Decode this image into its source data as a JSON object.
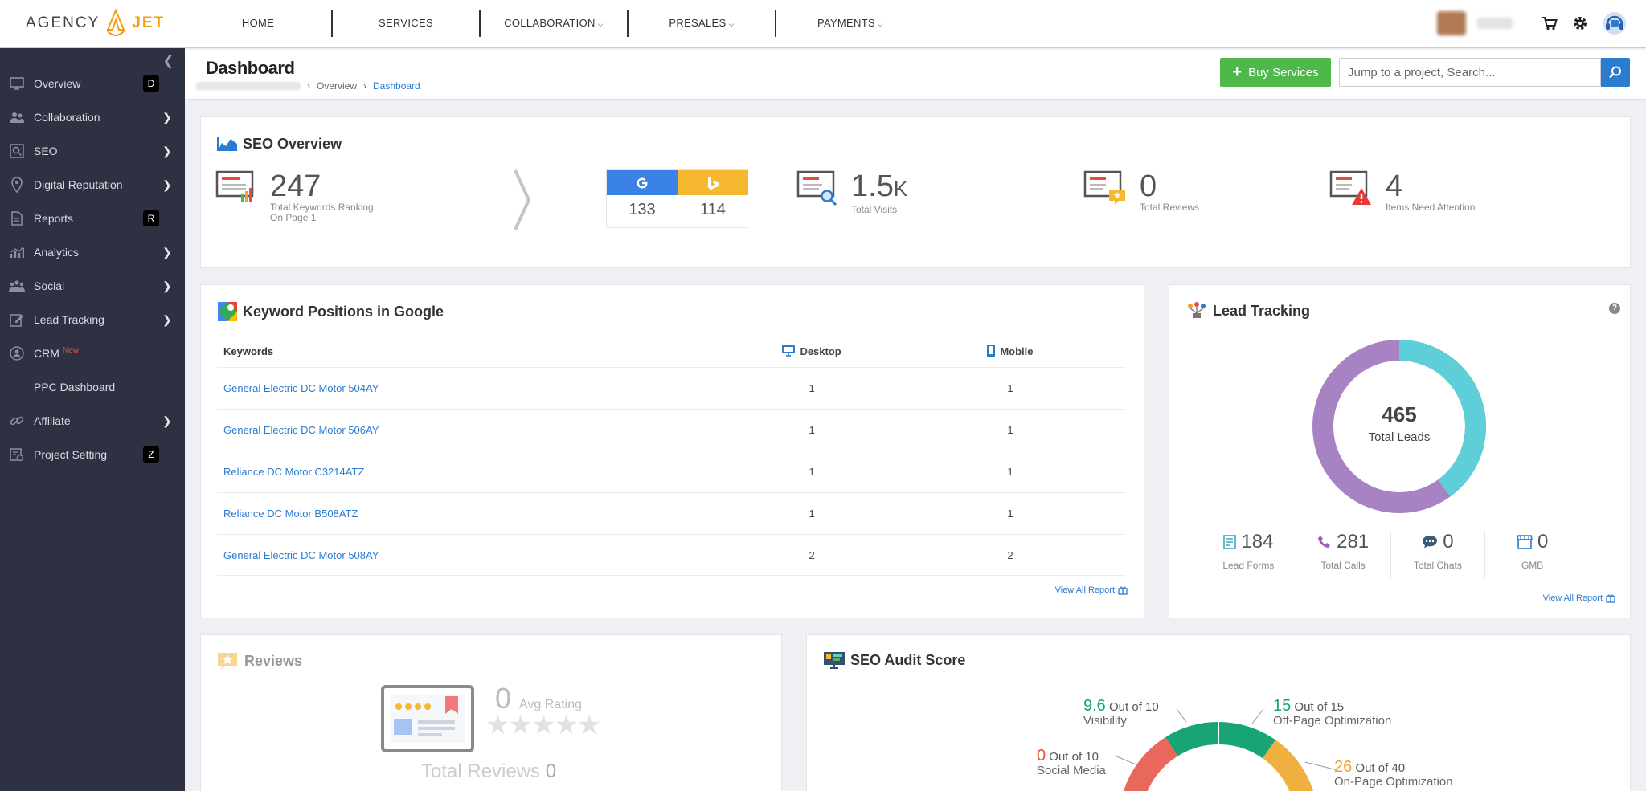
{
  "brand": {
    "name_left": "AGENCY",
    "name_right": "JET"
  },
  "nav": {
    "items": [
      "HOME",
      "SERVICES",
      "COLLABORATION",
      "PRESALES",
      "PAYMENTS"
    ]
  },
  "sidebar": {
    "items": [
      {
        "label": "Overview",
        "hotkey": "D"
      },
      {
        "label": "Collaboration"
      },
      {
        "label": "SEO"
      },
      {
        "label": "Digital Reputation"
      },
      {
        "label": "Reports",
        "hotkey": "R"
      },
      {
        "label": "Analytics"
      },
      {
        "label": "Social"
      },
      {
        "label": "Lead Tracking"
      },
      {
        "label": "CRM",
        "badge": "New"
      },
      {
        "label": "PPC Dashboard"
      },
      {
        "label": "Affiliate"
      },
      {
        "label": "Project Setting",
        "hotkey": "Z"
      }
    ]
  },
  "header": {
    "title": "Dashboard",
    "breadcrumb": [
      "Overview",
      "Dashboard"
    ],
    "buy_label": "Buy Services",
    "search_placeholder": "Jump to a project, Search..."
  },
  "seo_overview": {
    "title": "SEO Overview",
    "keywords": {
      "value": "247",
      "label1": "Total Keywords Ranking",
      "label2": "On Page 1"
    },
    "google": "133",
    "bing": "114",
    "visits": {
      "value": "1.5",
      "suffix": "K",
      "label": "Total Visits"
    },
    "reviews": {
      "value": "0",
      "label": "Total Reviews"
    },
    "attention": {
      "value": "4",
      "label": "Items Need Attention"
    }
  },
  "keyword_positions": {
    "title": "Keyword Positions in Google",
    "col_keywords": "Keywords",
    "col_desktop": "Desktop",
    "col_mobile": "Mobile",
    "rows": [
      {
        "keyword": "General Electric DC Motor 504AY",
        "desktop": "1",
        "mobile": "1"
      },
      {
        "keyword": "General Electric DC Motor 506AY",
        "desktop": "1",
        "mobile": "1"
      },
      {
        "keyword": "Reliance DC Motor C3214ATZ",
        "desktop": "1",
        "mobile": "1"
      },
      {
        "keyword": "Reliance DC Motor B508ATZ",
        "desktop": "1",
        "mobile": "1"
      },
      {
        "keyword": "General Electric DC Motor 508AY",
        "desktop": "2",
        "mobile": "2"
      }
    ],
    "view_all": "View All Report"
  },
  "lead_tracking": {
    "title": "Lead Tracking",
    "total": "465",
    "total_label": "Total Leads",
    "share_teal": 0.4,
    "stats": [
      {
        "value": "184",
        "label": "Lead Forms"
      },
      {
        "value": "281",
        "label": "Total Calls"
      },
      {
        "value": "0",
        "label": "Total Chats"
      },
      {
        "value": "0",
        "label": "GMB"
      }
    ],
    "view_all": "View All Report"
  },
  "reviews": {
    "title": "Reviews",
    "avg_value": "0",
    "avg_label": "Avg Rating",
    "total_label": "Total Reviews",
    "total_value": "0"
  },
  "seo_audit": {
    "title": "SEO Audit Score",
    "items": [
      {
        "score": "9.6",
        "outof": "Out of 10",
        "label": "Visibility",
        "color": "#17a673"
      },
      {
        "score": "15",
        "outof": "Out of 15",
        "label": "Off-Page Optimization",
        "color": "#17a673"
      },
      {
        "score": "0",
        "outof": "Out of 10",
        "label": "Social Media",
        "color": "#e74c3c"
      },
      {
        "score": "26",
        "outof": "Out of 40",
        "label": "On-Page Optimization",
        "color": "#f0a030"
      }
    ]
  },
  "colors": {
    "accent": "#2b7bd0",
    "buy": "#4cb94a",
    "sidebar": "#2e3141",
    "donut_teal": "#5ecfd9",
    "donut_purple": "#a783c4",
    "google": "#3b82e6",
    "bing": "#f5b82e"
  }
}
